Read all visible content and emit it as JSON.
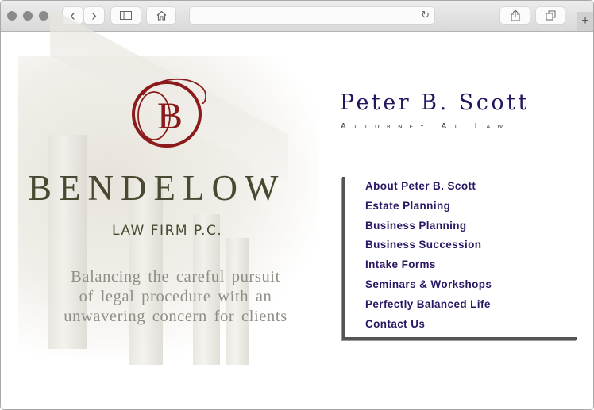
{
  "browser": {
    "traffic_lights": [
      "close",
      "minimize",
      "zoom"
    ],
    "back_icon": "‹",
    "forward_icon": "›",
    "sidebar_icon": "sidebar-icon",
    "home_icon": "⌂",
    "url_value": "",
    "reload_icon": "↻",
    "share_icon": "⇪",
    "tabs_icon": "⧉",
    "new_tab_icon": "+"
  },
  "hero": {
    "logo_letter": "B",
    "brand_name": "BENDELOW",
    "firm_label": "LAW FIRM P.C.",
    "tagline_lines": [
      "Balancing the careful pursuit",
      "of legal procedure with an",
      "unwavering concern for clients"
    ]
  },
  "header": {
    "name": "Peter B. Scott",
    "title": "Attorney At Law"
  },
  "nav": {
    "items": [
      {
        "label": "About Peter B. Scott"
      },
      {
        "label": "Estate Planning"
      },
      {
        "label": "Business Planning"
      },
      {
        "label": "Business Succession"
      },
      {
        "label": "Intake Forms"
      },
      {
        "label": "Seminars & Workshops"
      },
      {
        "label": "Perfectly Balanced Life"
      },
      {
        "label": "Contact Us"
      }
    ]
  },
  "colors": {
    "nav_link": "#2a1663",
    "logo_red": "#8b1a1a",
    "brand_olive": "#4a4a32",
    "name_purple": "#26145e"
  }
}
